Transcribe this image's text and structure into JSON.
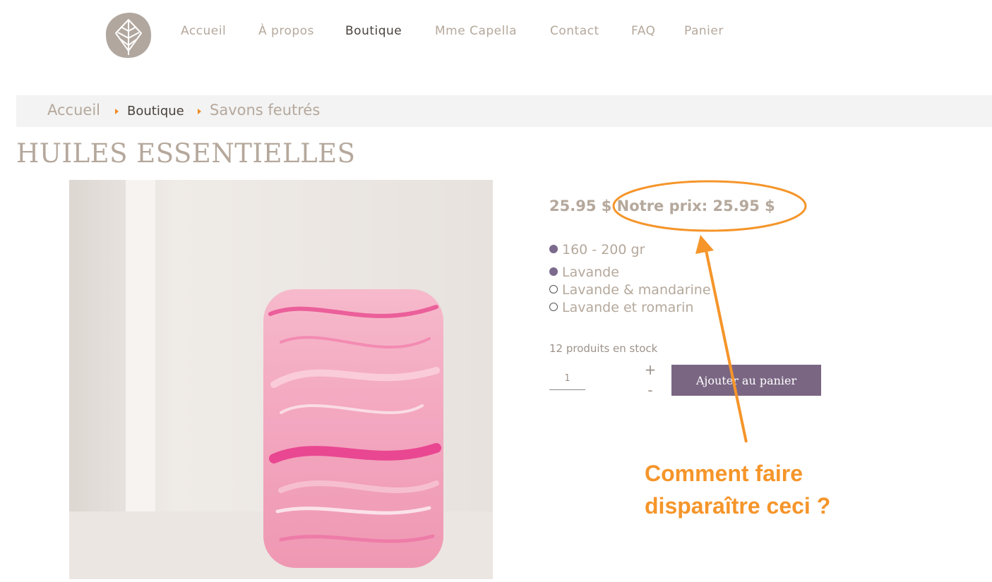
{
  "header": {
    "logo_icon": "leaf-icon",
    "nav": [
      {
        "label": "Accueil",
        "active": false
      },
      {
        "label": "À propos",
        "active": false
      },
      {
        "label": "Boutique",
        "active": true
      },
      {
        "label": "Mme Capella",
        "active": false
      },
      {
        "label": "Contact",
        "active": false
      },
      {
        "label": "FAQ",
        "active": false
      },
      {
        "label": "Panier",
        "active": false
      }
    ]
  },
  "breadcrumb": {
    "items": [
      "Accueil",
      "Boutique",
      "Savons feutrés"
    ],
    "separator_icon": "triangle-right-icon",
    "separator_color": "#f08a24"
  },
  "page": {
    "title": "HUILES ESSENTIELLES"
  },
  "product": {
    "price_line": "25.95 $ Notre prix: 25.95 $",
    "weight_options": [
      {
        "label": "160 - 200 gr",
        "selected": true
      }
    ],
    "scent_options": [
      {
        "label": "Lavande",
        "selected": true
      },
      {
        "label": "Lavande & mandarine",
        "selected": false
      },
      {
        "label": "Lavande et romarin",
        "selected": false
      }
    ],
    "stock_text": "12 produits en stock",
    "quantity": "1",
    "plus_label": "+",
    "minus_label": "-",
    "add_to_cart_label": "Ajouter au panier",
    "button_color": "#7a6683"
  },
  "annotation": {
    "text_line1": "Comment faire",
    "text_line2": "disparaître ceci ?",
    "color": "#f5952a"
  },
  "colors": {
    "text_muted": "#b5a89c",
    "text_dark": "#4a423c",
    "breadcrumb_bg": "#f3f3f3"
  }
}
